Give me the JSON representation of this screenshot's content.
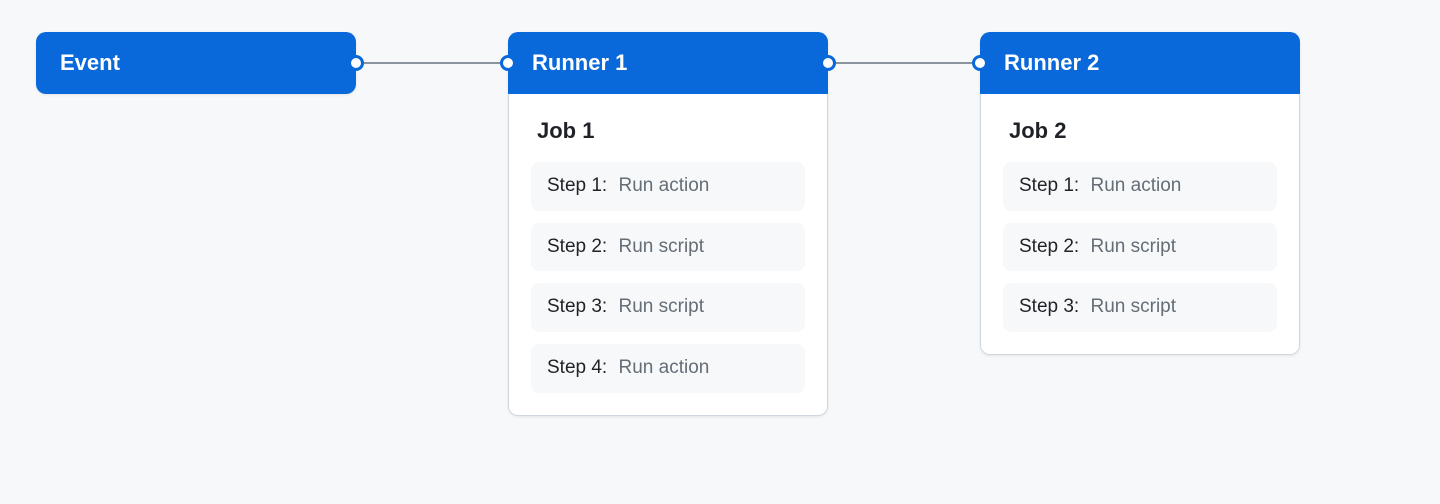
{
  "colors": {
    "accent": "#0969da",
    "bg": "#f6f8fa",
    "card": "#ffffff",
    "border": "#d0d7de",
    "muted": "#656d76",
    "text": "#1f2328"
  },
  "event": {
    "title": "Event"
  },
  "runner1": {
    "title": "Runner 1",
    "job_title": "Job 1",
    "steps": [
      {
        "label": "Step 1:",
        "desc": "Run action"
      },
      {
        "label": "Step 2:",
        "desc": "Run script"
      },
      {
        "label": "Step 3:",
        "desc": "Run script"
      },
      {
        "label": "Step 4:",
        "desc": "Run action"
      }
    ]
  },
  "runner2": {
    "title": "Runner 2",
    "job_title": "Job 2",
    "steps": [
      {
        "label": "Step 1:",
        "desc": "Run action"
      },
      {
        "label": "Step 2:",
        "desc": "Run script"
      },
      {
        "label": "Step 3:",
        "desc": "Run script"
      }
    ]
  }
}
